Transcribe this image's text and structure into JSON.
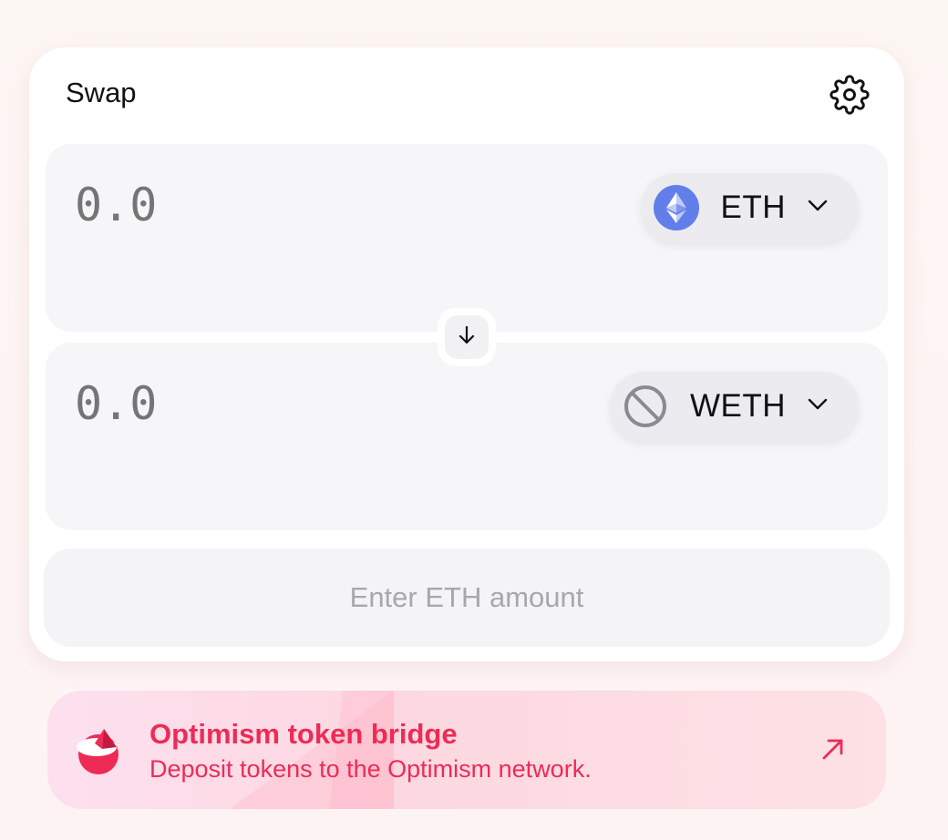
{
  "swap": {
    "title": "Swap",
    "settings_icon": "gear-icon",
    "input": {
      "placeholder": "0.0",
      "value": "",
      "token_symbol": "ETH",
      "token_icon": "ethereum-icon"
    },
    "switch_icon": "arrow-down-icon",
    "output": {
      "placeholder": "0.0",
      "value": "",
      "token_symbol": "WETH",
      "token_icon": "unsupported-token-icon"
    },
    "action_label": "Enter ETH amount"
  },
  "bridge_banner": {
    "title": "Optimism token bridge",
    "subtitle": "Deposit tokens to the Optimism network.",
    "logo_icon": "optimism-logo-icon",
    "link_icon": "arrow-up-right-icon"
  },
  "colors": {
    "accent_red": "#ee2b56",
    "eth_blue": "#627eea",
    "panel_bg": "#f6f6f8"
  }
}
